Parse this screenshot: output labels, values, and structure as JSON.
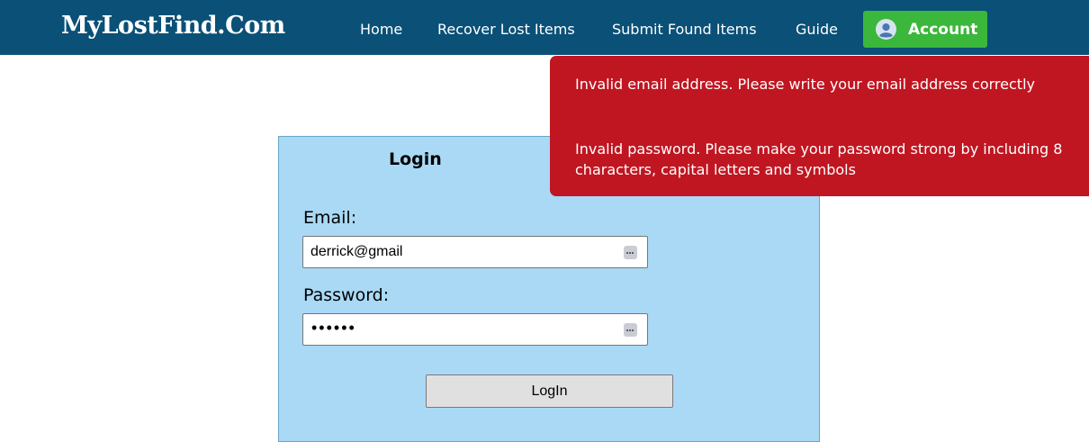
{
  "navbar": {
    "brand": "MyLostFind.Com",
    "links": [
      "Home",
      "Recover Lost Items",
      "Submit Found Items",
      "Guide"
    ],
    "account_label": "Account",
    "account_icon": "user-circle-icon"
  },
  "login": {
    "title": "Login",
    "email_label": "Email:",
    "email_value": "derrick@gmail",
    "password_label": "Password:",
    "password_mask": "••••••",
    "button_label": "LogIn"
  },
  "errors": {
    "email": "Invalid email address. Please write your email address correctly",
    "password": "Invalid password. Please make your password strong by including 8 characters, capital letters and symbols"
  },
  "colors": {
    "navbar": "#0a5077",
    "account_button": "#3bb73b",
    "panel": "#aad9f5",
    "error": "#c01621"
  }
}
